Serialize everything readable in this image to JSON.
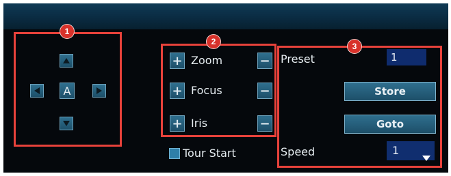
{
  "ptz": {
    "direction": {
      "up_icon": "arrow-up-icon",
      "down_icon": "arrow-down-icon",
      "left_icon": "arrow-left-icon",
      "right_icon": "arrow-right-icon",
      "auto_label": "A"
    },
    "lens": {
      "plus_symbol": "+",
      "minus_symbol": "−",
      "zoom_label": "Zoom",
      "focus_label": "Focus",
      "iris_label": "Iris"
    },
    "tour": {
      "label": "Tour Start",
      "checked": false
    },
    "preset": {
      "label": "Preset",
      "value": "1",
      "store_label": "Store",
      "goto_label": "Goto"
    },
    "speed": {
      "label": "Speed",
      "value": "1"
    }
  },
  "annotations": {
    "badge1": "1",
    "badge2": "2",
    "badge3": "3"
  },
  "colors": {
    "panel_bg": "#05080c",
    "button": "#2a6482",
    "annotation_red": "#e8423b",
    "field_blue": "#0f2c6e"
  }
}
